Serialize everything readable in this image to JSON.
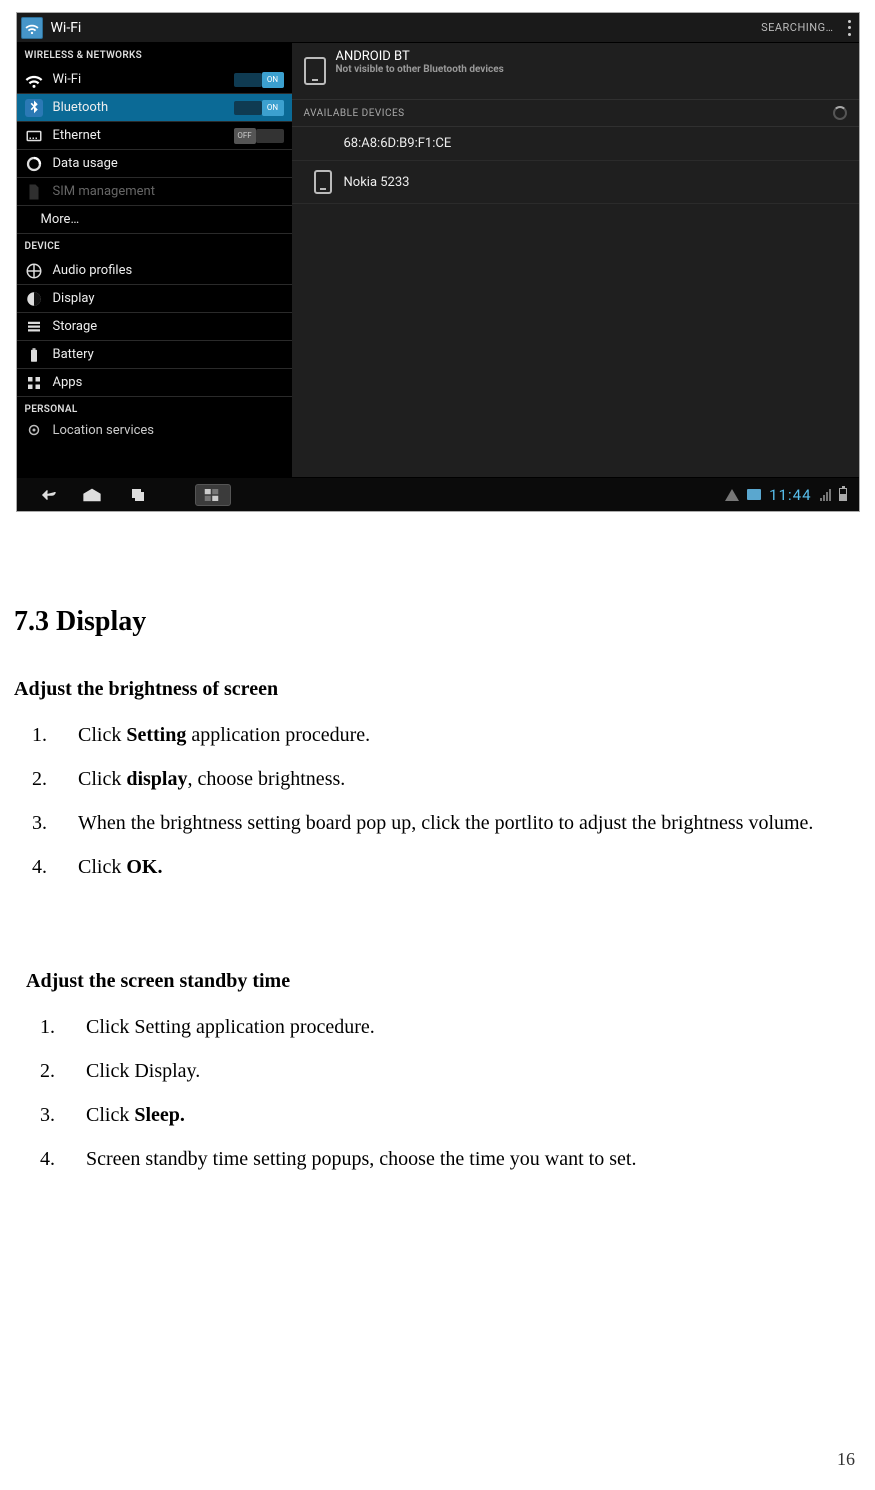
{
  "colors": {
    "accent": "#33b5e5",
    "selected": "#0b6a96"
  },
  "device": {
    "top": {
      "title": "Wi-Fi",
      "status": "SEARCHING…"
    },
    "sidebar": {
      "sections": {
        "wireless": "WIRELESS & NETWORKS",
        "device": "DEVICE",
        "personal": "PERSONAL"
      },
      "wifi": {
        "label": "Wi-Fi",
        "state": "ON"
      },
      "bluetooth": {
        "label": "Bluetooth",
        "state": "ON"
      },
      "ethernet": {
        "label": "Ethernet",
        "state": "OFF"
      },
      "datausage": {
        "label": "Data usage"
      },
      "sim": {
        "label": "SIM management"
      },
      "more": {
        "label": "More…"
      },
      "audio": {
        "label": "Audio profiles"
      },
      "display": {
        "label": "Display"
      },
      "storage": {
        "label": "Storage"
      },
      "battery": {
        "label": "Battery"
      },
      "apps": {
        "label": "Apps"
      },
      "location": {
        "label": "Location services"
      }
    },
    "main": {
      "self": {
        "name": "ANDROID BT",
        "sub": "Not visible to other Bluetooth devices"
      },
      "available_header": "AVAILABLE DEVICES",
      "dev1": "68:A8:6D:B9:F1:CE",
      "dev2": "Nokia 5233"
    },
    "navbar": {
      "clock": "11:44"
    }
  },
  "doc": {
    "heading": "7.3 Display",
    "brightness_title": "Adjust the brightness of screen",
    "brightness_steps": [
      {
        "pre": "Click ",
        "bold": "Setting",
        "post": " application procedure."
      },
      {
        "pre": "Click ",
        "bold": "display",
        "post": ", choose brightness."
      },
      {
        "pre": "When the brightness setting board pop up, click the portlito to adjust the brightness volume.",
        "bold": "",
        "post": ""
      },
      {
        "pre": "Click ",
        "bold": "OK.",
        "post": ""
      }
    ],
    "standby_title": "Adjust the screen standby time",
    "standby_steps": [
      {
        "pre": "Click Setting application procedure.",
        "bold": "",
        "post": ""
      },
      {
        "pre": "Click Display.",
        "bold": "",
        "post": ""
      },
      {
        "pre": "Click ",
        "bold": "Sleep.",
        "post": ""
      },
      {
        "pre": "Screen standby time setting popups, choose the time you want to set.",
        "bold": "",
        "post": ""
      }
    ],
    "page_number": "16"
  }
}
